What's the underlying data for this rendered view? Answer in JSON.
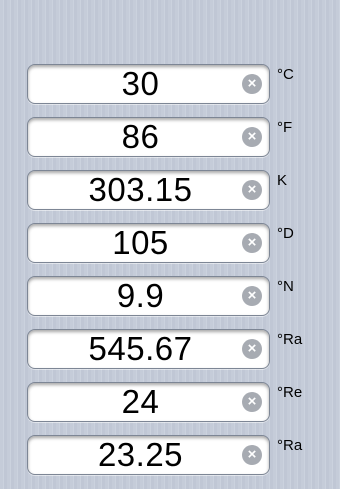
{
  "conversions": [
    {
      "value": "30",
      "unit": "°C"
    },
    {
      "value": "86",
      "unit": "°F"
    },
    {
      "value": "303.15",
      "unit": "K"
    },
    {
      "value": "105",
      "unit": "°D"
    },
    {
      "value": "9.9",
      "unit": "°N"
    },
    {
      "value": "545.67",
      "unit": "°Ra"
    },
    {
      "value": "24",
      "unit": "°Re"
    },
    {
      "value": "23.25",
      "unit": "°Ra"
    }
  ],
  "clear_icon_glyph": "×",
  "icons": {
    "clear": "clear-icon"
  }
}
